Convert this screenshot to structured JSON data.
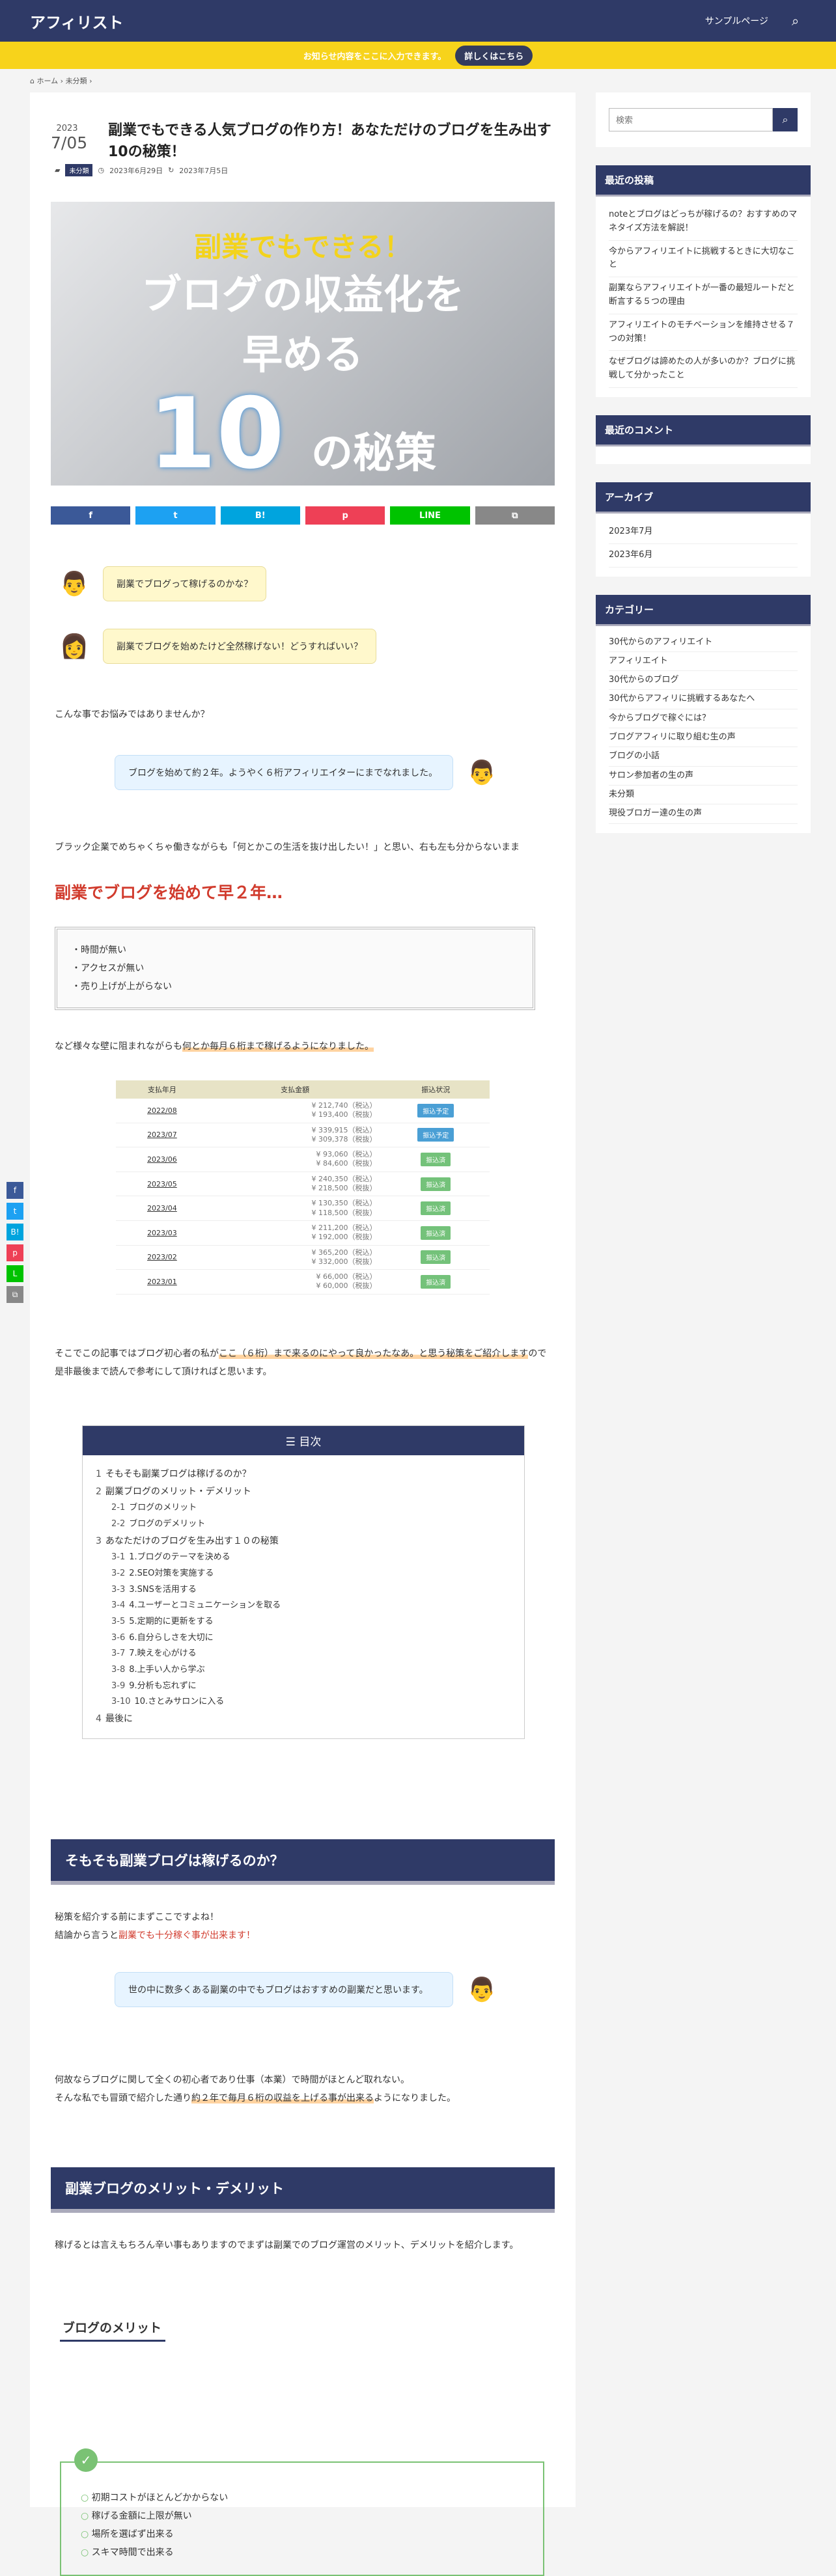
{
  "header": {
    "logo": "アフィリスト",
    "nav": "サンプルページ"
  },
  "notice": {
    "text": "お知らせ内容をここに入力できます。",
    "button": "詳しくはこちら"
  },
  "breadcrumb": {
    "home": "ホーム",
    "cat": "未分類"
  },
  "post": {
    "year": "2023",
    "date": "7/05",
    "title": "副業でもできる人気ブログの作り方！あなただけのブログを生み出す10の秘策！",
    "category": "未分類",
    "published": "2023年6月29日",
    "updated": "2023年7月5日"
  },
  "hero": {
    "line1": "副業でもできる！",
    "line2": "ブログの収益化を",
    "line3": "早める",
    "num": "10",
    "line4": "の秘策"
  },
  "share": [
    "f",
    "t",
    "B!",
    "p",
    "LINE",
    "⧉"
  ],
  "dialogs": {
    "d1": "副業でブログって稼げるのかな？",
    "d2": "副業でブログを始めたけど全然稼げない！どうすればいい？",
    "d3": "ブログを始めて約２年。ようやく６桁アフィリエイターにまでなれました。",
    "d4": "世の中に数多くある副業の中でもブログはおすすめの副業だと思います。"
  },
  "text": {
    "p1": "こんな事でお悩みではありませんか？",
    "p2": "ブラック企業でめちゃくちゃ働きながらも「何とかこの生活を抜け出したい！」と思い、右も左も分からないまま",
    "big": "副業でブログを始めて早２年…",
    "list": [
      "・時間が無い",
      "・アクセスが無い",
      "・売り上げが上がらない"
    ],
    "p3a": "など様々な壁に阻まれながらも",
    "p3b": "何とか毎月６桁まで稼げるようになりました。",
    "p4a": "そこでこの記事ではブログ初心者の私が",
    "p4b": "ここ（６桁）まで来るのにやって良かったなあ。と思う秘策をご紹介します",
    "p4c": "ので是非最後まで読んで参考にして頂ければと思います。",
    "p5a": "秘策を紹介する前にまずここですよね！",
    "p5b": "結論から言うと",
    "p5c": "副業でも十分稼ぐ事が出来ます！",
    "p6a": "何故ならブログに関して全くの初心者であり仕事（本業）で時間がほとんど取れない。",
    "p6b": "そんな私でも冒頭で紹介した通り",
    "p6c": "約２年で毎月６桁の収益を上げる事が出来る",
    "p6d": "ようになりました。",
    "p7": "稼げるとは言えもちろん辛い事もありますのでまずは副業でのブログ運営のメリット、デメリットを紹介します。"
  },
  "table": {
    "headers": [
      "支払年月",
      "支払金額",
      "振込状況"
    ],
    "rows": [
      [
        "2022/08",
        "¥ 212,740（税込）",
        "¥ 193,400（税抜）",
        "振込予定"
      ],
      [
        "2023/07",
        "¥ 339,915（税込）",
        "¥ 309,378（税抜）",
        "振込予定"
      ],
      [
        "2023/06",
        "¥ 93,060（税込）",
        "¥ 84,600（税抜）",
        "振込済"
      ],
      [
        "2023/05",
        "¥ 240,350（税込）",
        "¥ 218,500（税抜）",
        "振込済"
      ],
      [
        "2023/04",
        "¥ 130,350（税込）",
        "¥ 118,500（税抜）",
        "振込済"
      ],
      [
        "2023/03",
        "¥ 211,200（税込）",
        "¥ 192,000（税抜）",
        "振込済"
      ],
      [
        "2023/02",
        "¥ 365,200（税込）",
        "¥ 332,000（税抜）",
        "振込済"
      ],
      [
        "2023/01",
        "¥ 66,000（税込）",
        "¥ 60,000（税抜）",
        "振込済"
      ]
    ]
  },
  "toc": {
    "title": "目次",
    "items": [
      {
        "n": "1",
        "t": "そもそも副業ブログは稼げるのか？",
        "sub": false
      },
      {
        "n": "2",
        "t": "副業ブログのメリット・デメリット",
        "sub": false
      },
      {
        "n": "2-1",
        "t": "ブログのメリット",
        "sub": true
      },
      {
        "n": "2-2",
        "t": "ブログのデメリット",
        "sub": true
      },
      {
        "n": "3",
        "t": "あなただけのブログを生み出す１０の秘策",
        "sub": false
      },
      {
        "n": "3-1",
        "t": "1.ブログのテーマを決める",
        "sub": true
      },
      {
        "n": "3-2",
        "t": "2.SEO対策を実施する",
        "sub": true
      },
      {
        "n": "3-3",
        "t": "3.SNSを活用する",
        "sub": true
      },
      {
        "n": "3-4",
        "t": "4.ユーザーとコミュニケーションを取る",
        "sub": true
      },
      {
        "n": "3-5",
        "t": "5.定期的に更新をする",
        "sub": true
      },
      {
        "n": "3-6",
        "t": "6.自分らしさを大切に",
        "sub": true
      },
      {
        "n": "3-7",
        "t": "7.映えを心がける",
        "sub": true
      },
      {
        "n": "3-8",
        "t": "8.上手い人から学ぶ",
        "sub": true
      },
      {
        "n": "3-9",
        "t": "9.分析も忘れずに",
        "sub": true
      },
      {
        "n": "3-10",
        "t": "10.さとみサロンに入る",
        "sub": true
      },
      {
        "n": "4",
        "t": "最後に",
        "sub": false
      }
    ]
  },
  "h2": {
    "s1": "そもそも副業ブログは稼げるのか？",
    "s2": "副業ブログのメリット・デメリット"
  },
  "h3": {
    "merit": "ブログのメリット"
  },
  "merits": [
    "初期コストがほとんどかからない",
    "稼げる金額に上限が無い",
    "場所を選ばず出来る",
    "スキマ時間で出来る"
  ],
  "sidebar": {
    "search_placeholder": "検索",
    "recent_title": "最近の投稿",
    "recent": [
      "noteとブログはどっちが稼げるの？おすすめのマネタイズ方法を解説！",
      "今からアフィリエイトに挑戦するときに大切なこと",
      "副業ならアフィリエイトが一番の最短ルートだと断言する５つの理由",
      "アフィリエイトのモチベーションを維持させる７つの対策！",
      "なぜブログは諦めたの人が多いのか？ブログに挑戦して分かったこと"
    ],
    "comments_title": "最近のコメント",
    "archive_title": "アーカイブ",
    "archives": [
      "2023年7月",
      "2023年6月"
    ],
    "category_title": "カテゴリー",
    "categories": [
      "30代からのアフィリエイト",
      "アフィリエイト",
      "30代からのブログ",
      "30代からアフィリに挑戦するあなたへ",
      "今からブログで稼ぐには？",
      "ブログアフィリに取り組む生の声",
      "ブログの小話",
      "サロン参加者の生の声",
      "未分類",
      "現役ブロガー達の生の声"
    ]
  },
  "colors": {
    "navy": "#2f3a67",
    "fb": "#3b5998",
    "tw": "#1da1f2",
    "hb": "#00a4de",
    "pocket": "#ee4056",
    "line": "#00c300",
    "copy": "#888888"
  }
}
